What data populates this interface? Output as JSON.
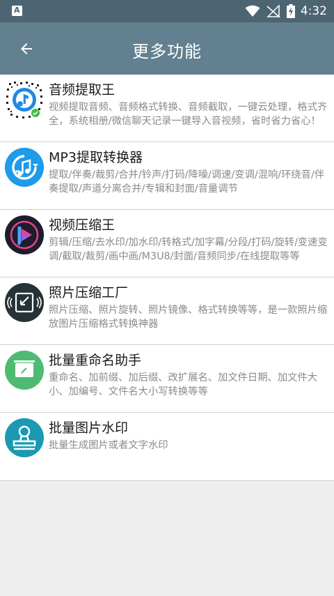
{
  "status_bar": {
    "badge_letter": "A",
    "time": "4:32"
  },
  "app_bar": {
    "title": "更多功能"
  },
  "items": [
    {
      "icon": "qr-code-music-icon",
      "name": "音频提取王",
      "desc": "视频提取音频、音频格式转换、音频截取，一键云处理，格式齐全，系统相册/微信聊天记录一键导入音视频，省时省力省心！"
    },
    {
      "icon": "music-note-circle-icon",
      "name": "MP3提取转换器",
      "desc": "提取/伴奏/裁剪/合并/铃声/打码/降噪/调速/变调/混响/环绕音/伴奏提取/声道分离合并/专辑和封面/音量调节"
    },
    {
      "icon": "video-play-circle-icon",
      "name": "视频压缩王",
      "desc": "剪辑/压缩/去水印/加水印/转格式/加字幕/分段/打码/旋转/变速变调/截取/裁剪/画中画/M3U8/封面/音频同步/在线提取等等"
    },
    {
      "icon": "photo-compress-icon",
      "name": "照片压缩工厂",
      "desc": "照片压缩、照片旋转、照片镜像、格式转换等等，是一款照片缩放图片压缩格式转换神器"
    },
    {
      "icon": "rename-edit-icon",
      "name": "批量重命名助手",
      "desc": "重命名、加前缀、加后缀、改扩展名、加文件日期、加文件大小、加编号、文件名大小写转换等等"
    },
    {
      "icon": "stamp-watermark-icon",
      "name": "批量图片水印",
      "desc": "批量生成图片或者文字水印"
    }
  ]
}
